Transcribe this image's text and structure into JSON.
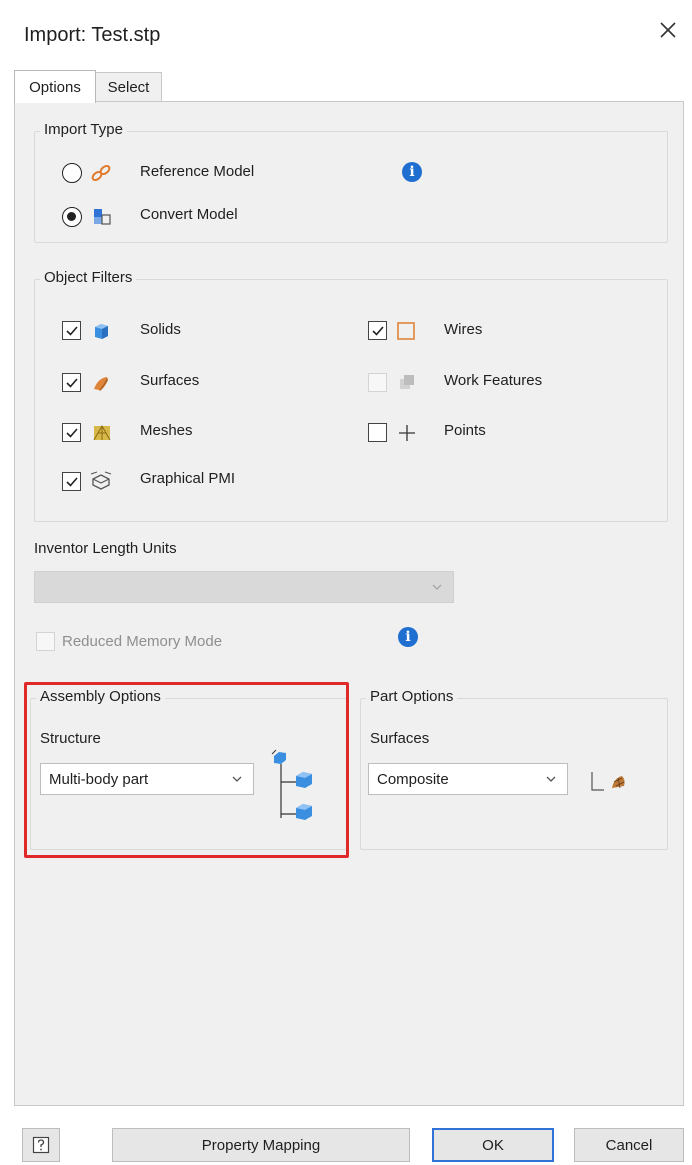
{
  "window": {
    "title": "Import: Test.stp",
    "close_glyph": "×"
  },
  "tabs": [
    {
      "label": "Options",
      "active": true
    },
    {
      "label": "Select",
      "active": false
    }
  ],
  "import_type": {
    "legend": "Import Type",
    "options": [
      {
        "label": "Reference Model",
        "selected": false,
        "icon": "chain-link-icon"
      },
      {
        "label": "Convert Model",
        "selected": true,
        "icon": "convert-blocks-icon"
      }
    ],
    "info_glyph": "i"
  },
  "object_filters": {
    "legend": "Object Filters",
    "items": [
      {
        "label": "Solids",
        "checked": true,
        "enabled": true,
        "icon": "solid-cube-icon"
      },
      {
        "label": "Surfaces",
        "checked": true,
        "enabled": true,
        "icon": "surface-icon"
      },
      {
        "label": "Meshes",
        "checked": true,
        "enabled": true,
        "icon": "mesh-icon"
      },
      {
        "label": "Graphical PMI",
        "checked": true,
        "enabled": true,
        "icon": "pmi-icon"
      },
      {
        "label": "Wires",
        "checked": true,
        "enabled": true,
        "icon": "wire-rect-icon"
      },
      {
        "label": "Work Features",
        "checked": false,
        "enabled": false,
        "icon": "work-features-icon"
      },
      {
        "label": "Points",
        "checked": false,
        "enabled": true,
        "icon": "point-cross-icon"
      }
    ]
  },
  "length_units": {
    "label": "Inventor Length Units",
    "value": "",
    "enabled": false
  },
  "reduced_memory": {
    "label": "Reduced Memory Mode",
    "checked": false,
    "enabled": false,
    "info_glyph": "i"
  },
  "assembly_options": {
    "legend": "Assembly Options",
    "structure_label": "Structure",
    "structure_value": "Multi-body part",
    "icon": "assembly-tree-icon"
  },
  "part_options": {
    "legend": "Part Options",
    "surfaces_label": "Surfaces",
    "surfaces_value": "Composite",
    "icon": "composite-surface-icon"
  },
  "footer": {
    "help_icon": "help-icon",
    "property_mapping": "Property Mapping",
    "ok": "OK",
    "cancel": "Cancel"
  },
  "colors": {
    "accent_blue": "#2f73d6",
    "highlight_red": "#e02a2a",
    "panel_bg": "#f0f0f0",
    "info_blue": "#1f6fd1"
  }
}
